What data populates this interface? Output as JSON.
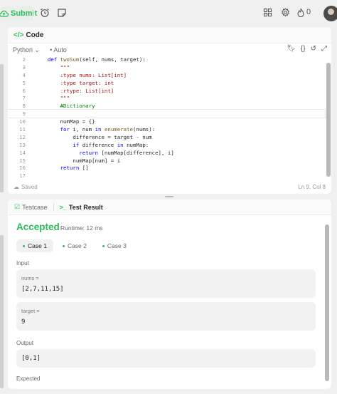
{
  "topbar": {
    "submit_label": "Submit",
    "streak_count": "0"
  },
  "editor": {
    "title": "Code",
    "language": "Python",
    "mode": "Auto",
    "lines": [
      {
        "n": "2",
        "t": "    def twoSum(self, nums, target):"
      },
      {
        "n": "3",
        "t": "        \"\"\""
      },
      {
        "n": "4",
        "t": "        :type nums: List[int]"
      },
      {
        "n": "5",
        "t": "        :type target: int"
      },
      {
        "n": "6",
        "t": "        :rtype: List[int]"
      },
      {
        "n": "7",
        "t": "        \"\"\""
      },
      {
        "n": "8",
        "t": "        #Dictionary"
      },
      {
        "n": "9",
        "t": ""
      },
      {
        "n": "10",
        "t": "        numMap = {}"
      },
      {
        "n": "11",
        "t": "        for i, num in enumerate(nums):"
      },
      {
        "n": "12",
        "t": "            difference = target - num"
      },
      {
        "n": "13",
        "t": "            if difference in numMap:"
      },
      {
        "n": "14",
        "t": "              return [numMap[difference], i]"
      },
      {
        "n": "15",
        "t": "            numMap[num] = i"
      },
      {
        "n": "16",
        "t": "        return []"
      },
      {
        "n": "17",
        "t": ""
      }
    ],
    "status_saved": "Saved",
    "cursor_pos": "Ln 9, Col 8"
  },
  "result": {
    "tab_testcase": "Testcase",
    "tab_result": "Test Result",
    "verdict": "Accepted",
    "runtime": "Runtime: 12 ms",
    "cases": [
      "Case 1",
      "Case 2",
      "Case 3"
    ],
    "input_label": "Input",
    "nums_key": "nums =",
    "nums_val": "[2,7,11,15]",
    "target_key": "target =",
    "target_val": "9",
    "output_label": "Output",
    "output_val": "[0,1]",
    "expected_label": "Expected"
  },
  "colors": {
    "accent": "#2cbb5d",
    "keyword": "#0000ff",
    "function": "#795e26",
    "comment": "#008000"
  }
}
